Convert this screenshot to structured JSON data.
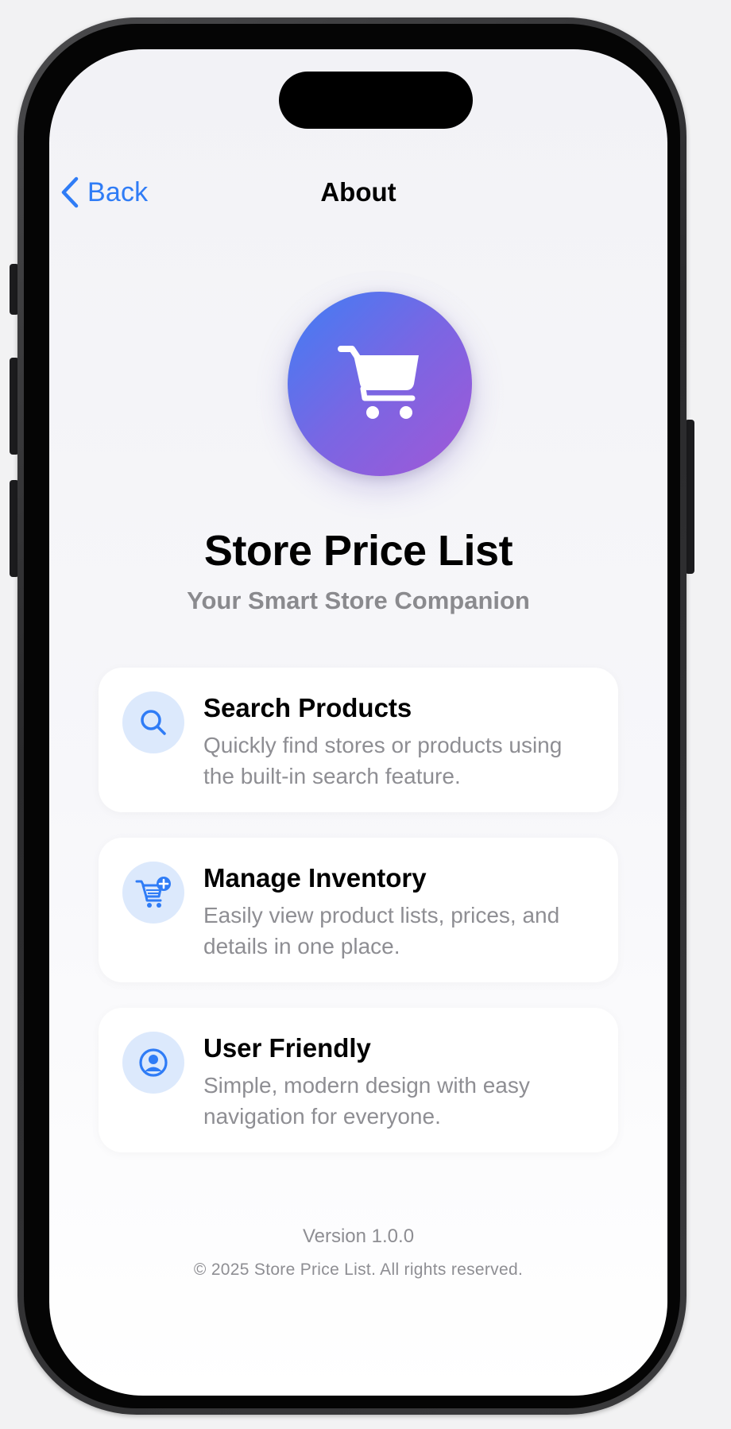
{
  "nav": {
    "back_label": "Back",
    "title": "About"
  },
  "hero": {
    "icon": "shopping-cart-icon",
    "app_name": "Store Price List",
    "tagline": "Your Smart Store Companion"
  },
  "features": [
    {
      "icon": "search-icon",
      "title": "Search Products",
      "description": "Quickly find stores or products using the built-in search feature."
    },
    {
      "icon": "cart-plus-icon",
      "title": "Manage Inventory",
      "description": "Easily view product lists, prices, and details in one place."
    },
    {
      "icon": "user-circle-icon",
      "title": "User Friendly",
      "description": "Simple, modern design with easy navigation for everyone."
    }
  ],
  "footer": {
    "version": "Version 1.0.0",
    "copyright": "© 2025 Store Price List. All rights reserved."
  },
  "colors": {
    "accent": "#2f7cf6",
    "hero_gradient_start": "#3f7ef5",
    "hero_gradient_end": "#a257d6",
    "icon_badge_bg": "#dce9fc",
    "secondary_text": "#8e8e93"
  }
}
